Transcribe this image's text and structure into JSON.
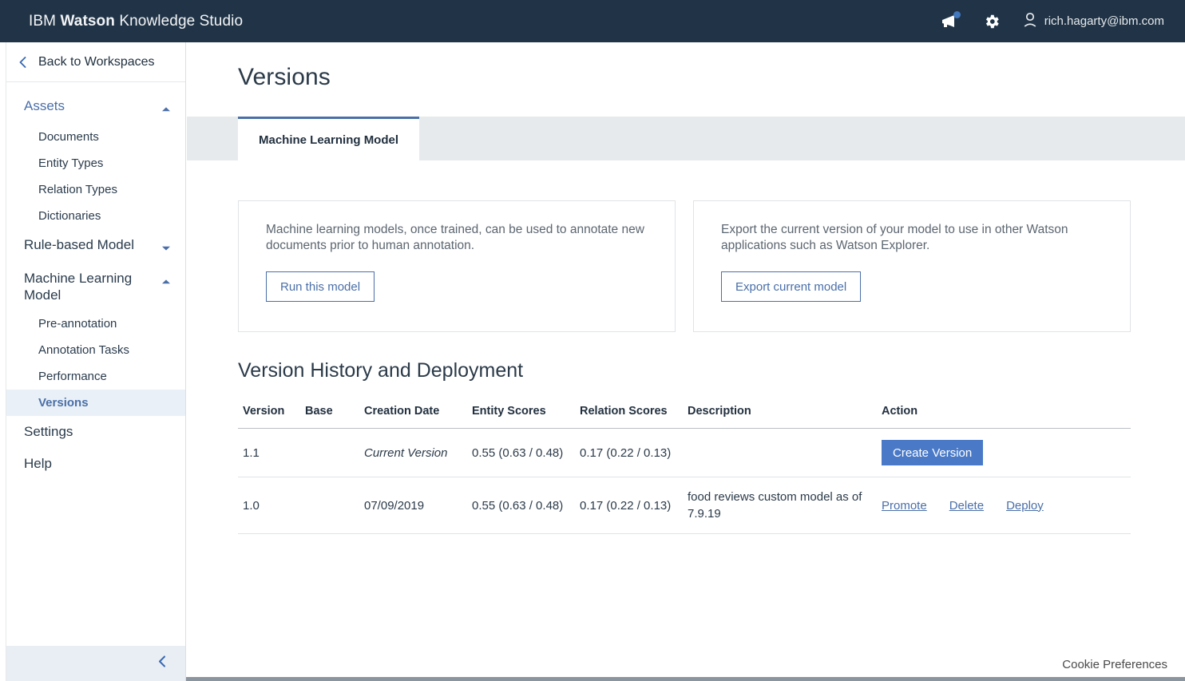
{
  "header": {
    "brand_prefix": "IBM ",
    "brand_strong": "Watson",
    "brand_suffix": " Knowledge Studio",
    "announcement_icon": "megaphone-icon",
    "settings_icon": "gear-icon",
    "user_icon": "user-avatar-icon",
    "user_email": "rich.hagarty@ibm.com",
    "background_color": "#213447"
  },
  "sidebar": {
    "back_label": "Back to Workspaces",
    "back_icon": "chevron-left-icon",
    "groups": [
      {
        "label": "Assets",
        "expanded": true,
        "caret": "caret-up-icon",
        "accent": true,
        "items": [
          {
            "label": "Documents",
            "active": false
          },
          {
            "label": "Entity Types",
            "active": false
          },
          {
            "label": "Relation Types",
            "active": false
          },
          {
            "label": "Dictionaries",
            "active": false
          }
        ]
      },
      {
        "label": "Rule-based Model",
        "expanded": false,
        "caret": "caret-down-icon",
        "accent": false,
        "items": []
      },
      {
        "label": "Machine Learning Model",
        "expanded": true,
        "caret": "caret-up-icon",
        "accent": false,
        "items": [
          {
            "label": "Pre-annotation",
            "active": false
          },
          {
            "label": "Annotation Tasks",
            "active": false
          },
          {
            "label": "Performance",
            "active": false
          },
          {
            "label": "Versions",
            "active": true
          }
        ]
      }
    ],
    "plain_items": [
      {
        "label": "Settings"
      },
      {
        "label": "Help"
      }
    ],
    "collapse_icon": "chevron-left-icon",
    "active_color": "#4a6fa8"
  },
  "main": {
    "page_title": "Versions",
    "tabs": [
      {
        "label": "Machine Learning Model",
        "active": true
      }
    ],
    "cards": [
      {
        "text": "Machine learning models, once trained, can be used to annotate new documents prior to human annotation.",
        "button_label": "Run this model"
      },
      {
        "text": "Export the current version of your model to use in other Watson applications such as Watson Explorer.",
        "button_label": "Export current model"
      }
    ],
    "section_title": "Version History and Deployment",
    "table": {
      "columns": [
        "Version",
        "Base",
        "Creation Date",
        "Entity Scores",
        "Relation Scores",
        "Description",
        "Action"
      ],
      "rows": [
        {
          "version": "1.1",
          "base": "",
          "creation_date": "Current Version",
          "creation_date_italic": true,
          "entity_scores": "0.55 (0.63 / 0.48)",
          "relation_scores": "0.17 (0.22 / 0.13)",
          "description": "",
          "action_type": "button",
          "action_button": "Create Version",
          "action_links": []
        },
        {
          "version": "1.0",
          "base": "",
          "creation_date": "07/09/2019",
          "creation_date_italic": false,
          "entity_scores": "0.55 (0.63 / 0.48)",
          "relation_scores": "0.17 (0.22 / 0.13)",
          "description": "food reviews custom model as of 7.9.19",
          "action_type": "links",
          "action_button": "",
          "action_links": [
            "Promote",
            "Delete",
            "Deploy"
          ]
        }
      ]
    }
  },
  "footer": {
    "cookie_preferences": "Cookie Preferences"
  }
}
